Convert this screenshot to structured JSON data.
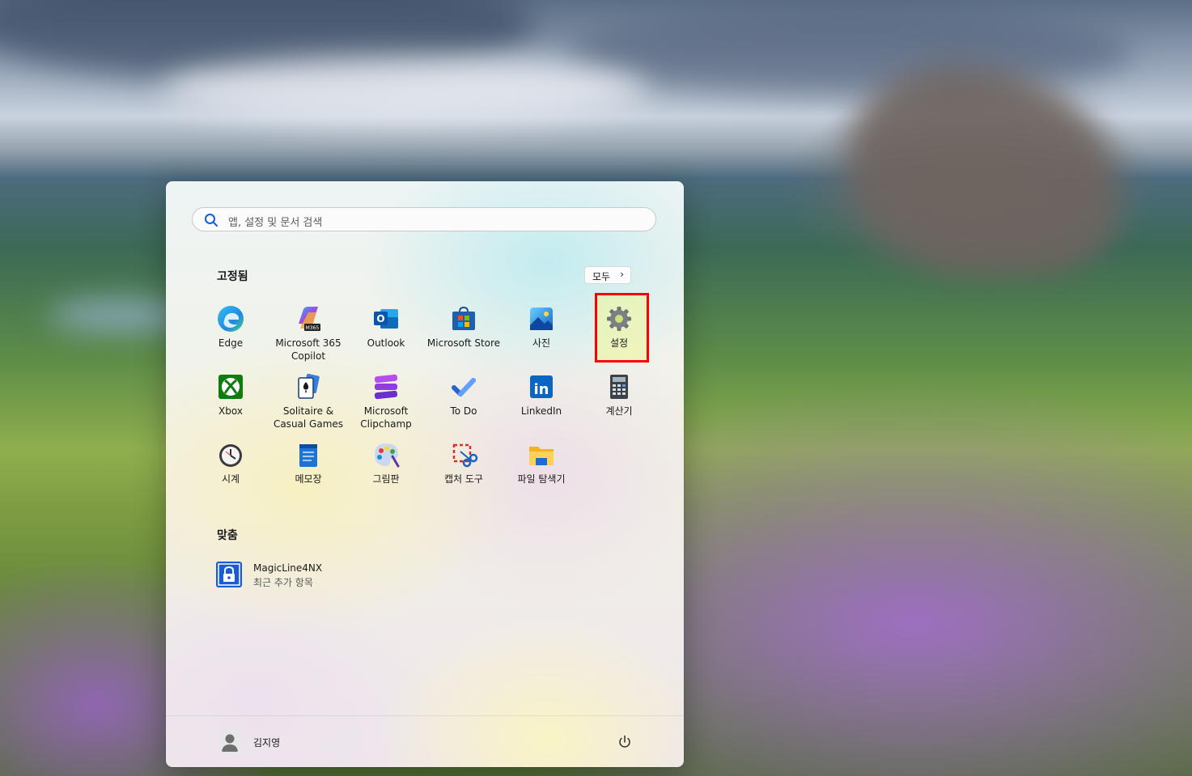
{
  "search": {
    "placeholder": "앱, 설정 및 문서 검색"
  },
  "pinned": {
    "title": "고정됨",
    "all_button": "모두",
    "apps": [
      {
        "label": "Edge",
        "icon": "edge-icon"
      },
      {
        "label": "Microsoft 365 Copilot",
        "icon": "m365-copilot-icon",
        "badge": "M365"
      },
      {
        "label": "Outlook",
        "icon": "outlook-icon",
        "letter": "O"
      },
      {
        "label": "Microsoft Store",
        "icon": "store-icon"
      },
      {
        "label": "사진",
        "icon": "photos-icon"
      },
      {
        "label": "설정",
        "icon": "gear-icon",
        "highlighted": true
      },
      {
        "label": "Xbox",
        "icon": "xbox-icon"
      },
      {
        "label": "Solitaire & Casual Games",
        "icon": "solitaire-icon"
      },
      {
        "label": "Microsoft Clipchamp",
        "icon": "clipchamp-icon"
      },
      {
        "label": "To Do",
        "icon": "todo-icon"
      },
      {
        "label": "LinkedIn",
        "icon": "linkedin-icon",
        "letter": "in"
      },
      {
        "label": "계산기",
        "icon": "calculator-icon"
      },
      {
        "label": "시계",
        "icon": "clock-icon"
      },
      {
        "label": "메모장",
        "icon": "notepad-icon"
      },
      {
        "label": "그림판",
        "icon": "paint-icon"
      },
      {
        "label": "캡처 도구",
        "icon": "snipping-tool-icon"
      },
      {
        "label": "파일 탐색기",
        "icon": "file-explorer-icon"
      }
    ]
  },
  "recommended": {
    "title": "맞춤",
    "items": [
      {
        "name": "MagicLine4NX",
        "subtitle": "최근 추가 항목",
        "icon": "lock-app-icon"
      }
    ]
  },
  "footer": {
    "user_name": "김지영",
    "power_icon": "power-icon"
  },
  "colors": {
    "highlight_border": "#ff0000",
    "accent": "#1a5bd6"
  }
}
